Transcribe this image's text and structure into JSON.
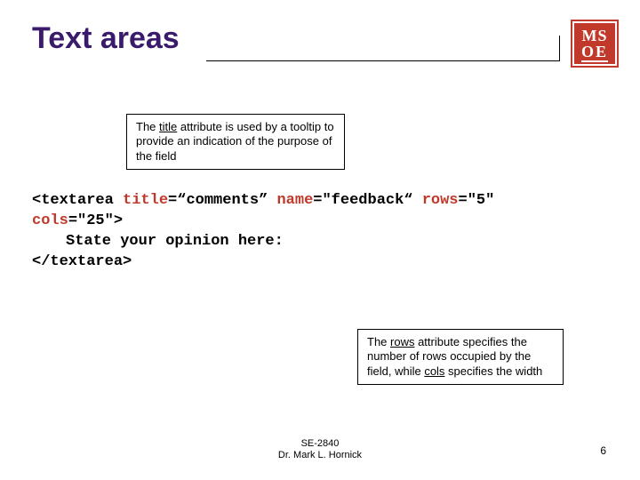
{
  "title": "Text areas",
  "logo": {
    "line1": "MS",
    "line2": "OE"
  },
  "callout1": {
    "prefix": "The ",
    "kw": "title",
    "rest": " attribute is used by a tooltip to provide an indication of the purpose of the field"
  },
  "callout2": {
    "prefix": "The ",
    "kw1": "rows",
    "mid": " attribute specifies the number of rows occupied by the field, while ",
    "kw2": "cols",
    "rest": " specifies the width"
  },
  "code": {
    "l1_open": "<textarea ",
    "l1_attr1": "title",
    "l1_eq1": "=“comments” ",
    "l1_attr2": "name",
    "l1_eq2": "=\"feedback“ ",
    "l1_attr3": "rows",
    "l1_eq3": "=\"5\"",
    "l2_attr": "cols",
    "l2_eq": "=\"25\">",
    "l3": "State your opinion here:",
    "l4": "</textarea>"
  },
  "footer": {
    "course": "SE-2840",
    "author": "Dr. Mark L. Hornick"
  },
  "page": "6"
}
